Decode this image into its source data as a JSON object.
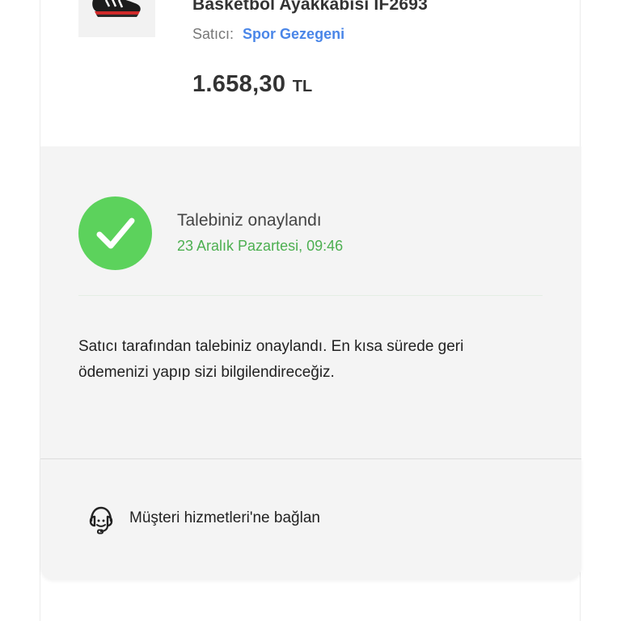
{
  "product": {
    "name": "Basketbol Ayakkabısı IF2693",
    "seller_label": "Satıcı:",
    "seller_name": "Spor Gezegeni",
    "price_amount": "1.658,30",
    "price_currency": "TL",
    "thumbnail_icon": "sneaker-image"
  },
  "status": {
    "icon": "check-icon",
    "title": "Talebiniz onaylandı",
    "date": "23 Aralık Pazartesi, 09:46",
    "message": "Satıcı tarafından talebiniz onaylandı. En kısa sürede geri ödemenizi yapıp sizi bilgilendireceğiz.",
    "color": "#5cd25c"
  },
  "support": {
    "icon": "headset-icon",
    "label": "Müşteri hizmetleri'ne bağlan"
  }
}
